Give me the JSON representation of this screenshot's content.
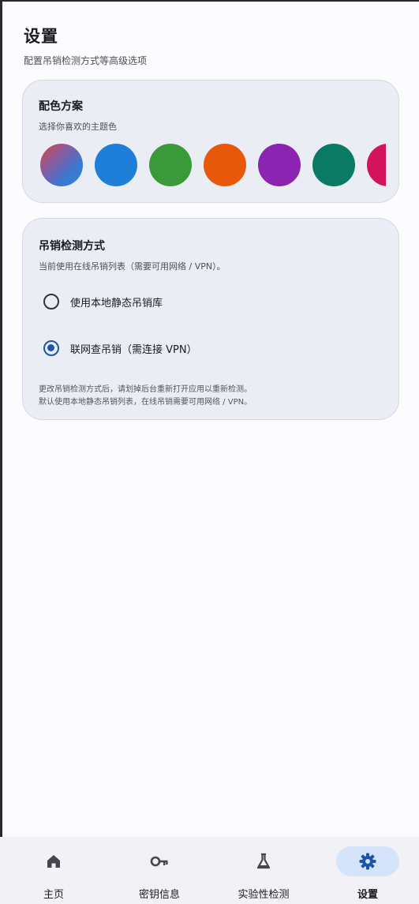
{
  "header": {
    "title": "设置",
    "subtitle": "配置吊销检测方式等高级选项"
  },
  "color_scheme": {
    "title": "配色方案",
    "subtitle": "选择你喜欢的主题色",
    "swatches": [
      {
        "name": "dynamic",
        "color": "#5a6fb8"
      },
      {
        "name": "blue",
        "color": "#1f7fd8"
      },
      {
        "name": "green",
        "color": "#3a9a3a"
      },
      {
        "name": "orange",
        "color": "#e8580b"
      },
      {
        "name": "purple",
        "color": "#8c24b2"
      },
      {
        "name": "teal",
        "color": "#0a7a64"
      },
      {
        "name": "pink",
        "color": "#d4145a"
      }
    ]
  },
  "revocation": {
    "title": "吊销检测方式",
    "subtitle": "当前使用在线吊销列表（需要可用网络 / VPN）。",
    "options": [
      {
        "label": "使用本地静态吊销库",
        "selected": false
      },
      {
        "label": "联网查吊销（需连接 VPN）",
        "selected": true
      }
    ],
    "note_line1": "更改吊销检测方式后，请划掉后台重新打开应用以重新检测。",
    "note_line2": "默认使用本地静态吊销列表，在线吊销需要可用网络 / VPN。"
  },
  "nav": {
    "items": [
      {
        "label": "主页",
        "icon": "home-icon",
        "active": false
      },
      {
        "label": "密钥信息",
        "icon": "key-icon",
        "active": false
      },
      {
        "label": "实验性检测",
        "icon": "flask-icon",
        "active": false
      },
      {
        "label": "设置",
        "icon": "gear-icon",
        "active": true
      }
    ]
  },
  "colors": {
    "accent": "#1d56a8",
    "nav_active_bg": "#d5e3fb",
    "card_bg": "#eaedf4",
    "page_bg": "#fcfbfe"
  }
}
